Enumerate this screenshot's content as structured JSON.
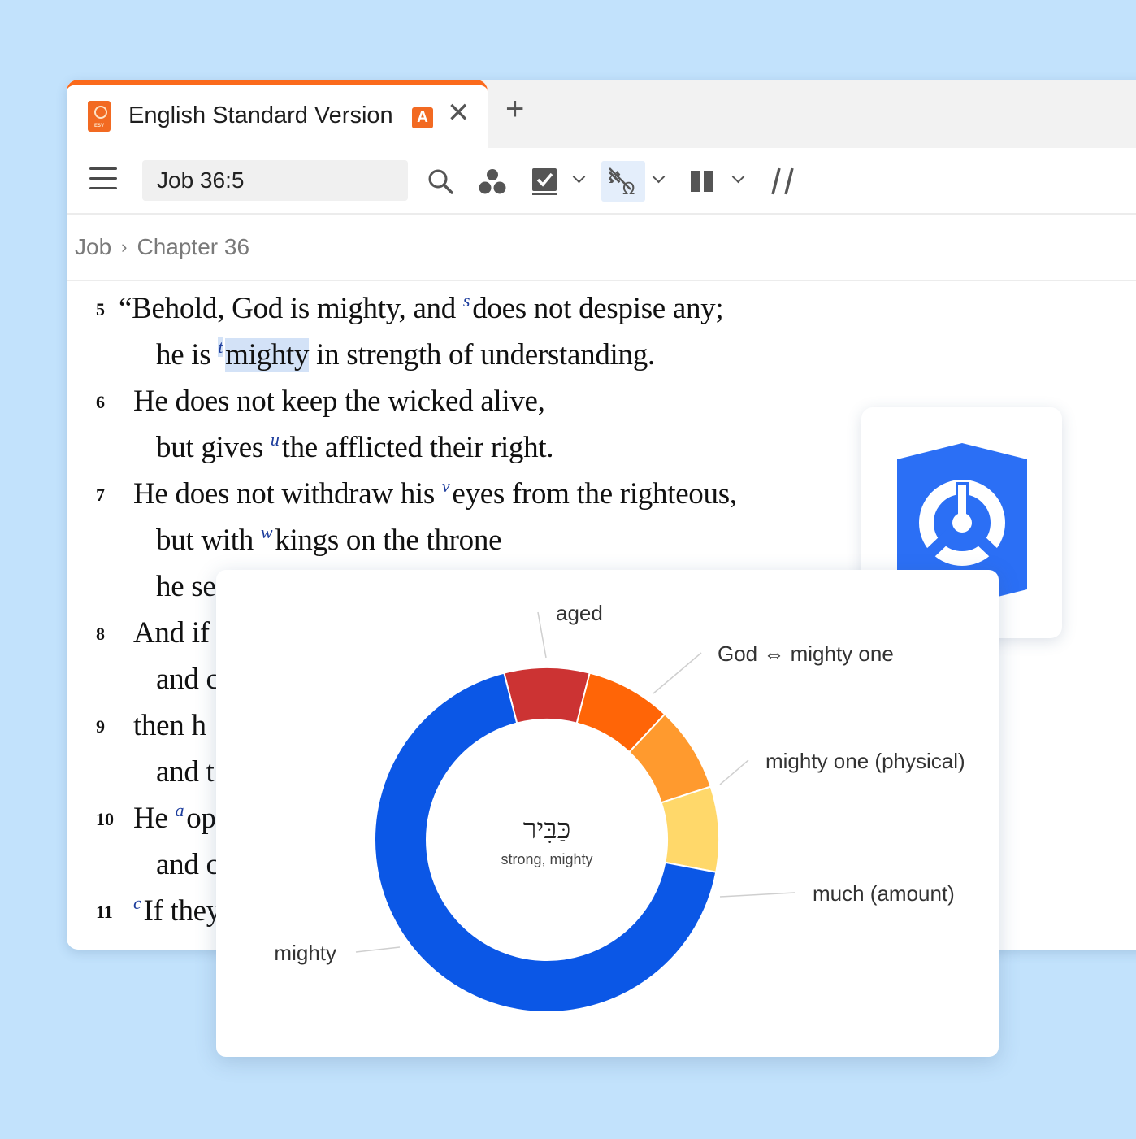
{
  "tab": {
    "title": "English Standard Version",
    "badge": "A",
    "close": "✕",
    "new_tab": "+"
  },
  "toolbar": {
    "reference": "Job 36:5",
    "icons": [
      "menu-icon",
      "search-icon",
      "cluster-icon",
      "checkbox-icon",
      "interlinear-icon",
      "columns-icon",
      "parallel-icon"
    ],
    "parallel_label": "//"
  },
  "breadcrumb": {
    "book": "Job",
    "separator": "›",
    "chapter": "Chapter 36"
  },
  "verses": [
    {
      "num": "5",
      "lines": [
        [
          {
            "t": "“Behold, God is mighty, and "
          },
          {
            "fn": "s"
          },
          {
            "t": "does not despise any;"
          }
        ],
        [
          {
            "t": "he is "
          },
          {
            "fn": "t",
            "hl": true
          },
          {
            "t": "mighty",
            "hl": true
          },
          {
            "t": " in strength of understanding."
          }
        ]
      ]
    },
    {
      "num": "6",
      "lines": [
        [
          {
            "t": "He does not keep the wicked alive,"
          }
        ],
        [
          {
            "t": "but gives "
          },
          {
            "fn": "u"
          },
          {
            "t": "the afflicted their right."
          }
        ]
      ]
    },
    {
      "num": "7",
      "lines": [
        [
          {
            "t": "He does not withdraw his "
          },
          {
            "fn": "v"
          },
          {
            "t": "eyes from the righteous,"
          }
        ],
        [
          {
            "t": "but with "
          },
          {
            "fn": "w"
          },
          {
            "t": "kings on the throne"
          }
        ],
        [
          {
            "t": "he se"
          }
        ]
      ]
    },
    {
      "num": "8",
      "lines": [
        [
          {
            "t": "And if"
          }
        ],
        [
          {
            "t": "and c"
          }
        ]
      ]
    },
    {
      "num": "9",
      "lines": [
        [
          {
            "t": "then h"
          }
        ],
        [
          {
            "t": "and t"
          }
        ]
      ]
    },
    {
      "num": "10",
      "lines": [
        [
          {
            "t": "He "
          },
          {
            "fn": "a"
          },
          {
            "t": "op"
          }
        ],
        [
          {
            "t": "and c"
          }
        ]
      ]
    },
    {
      "num": "11",
      "lines": [
        [
          {
            "fn": "c"
          },
          {
            "t": "If they"
          }
        ]
      ]
    }
  ],
  "logo": {
    "icon": "logos-shield-icon",
    "color": "#2b6ff5"
  },
  "chart_data": {
    "type": "pie",
    "style": "donut",
    "center_text": "כַּבִּיר",
    "center_subtext": "strong, mighty",
    "slices": [
      {
        "label": "aged",
        "value": 8,
        "color": "#cc3333"
      },
      {
        "label": "God ⇔ mighty one",
        "value": 8,
        "color": "#ff6507"
      },
      {
        "label": "mighty one (physical)",
        "value": 8,
        "color": "#ff9a2e"
      },
      {
        "label": "much (amount)",
        "value": 8,
        "color": "#ffd86a"
      },
      {
        "label": "mighty",
        "value": 68,
        "color": "#0b57e6"
      }
    ]
  }
}
